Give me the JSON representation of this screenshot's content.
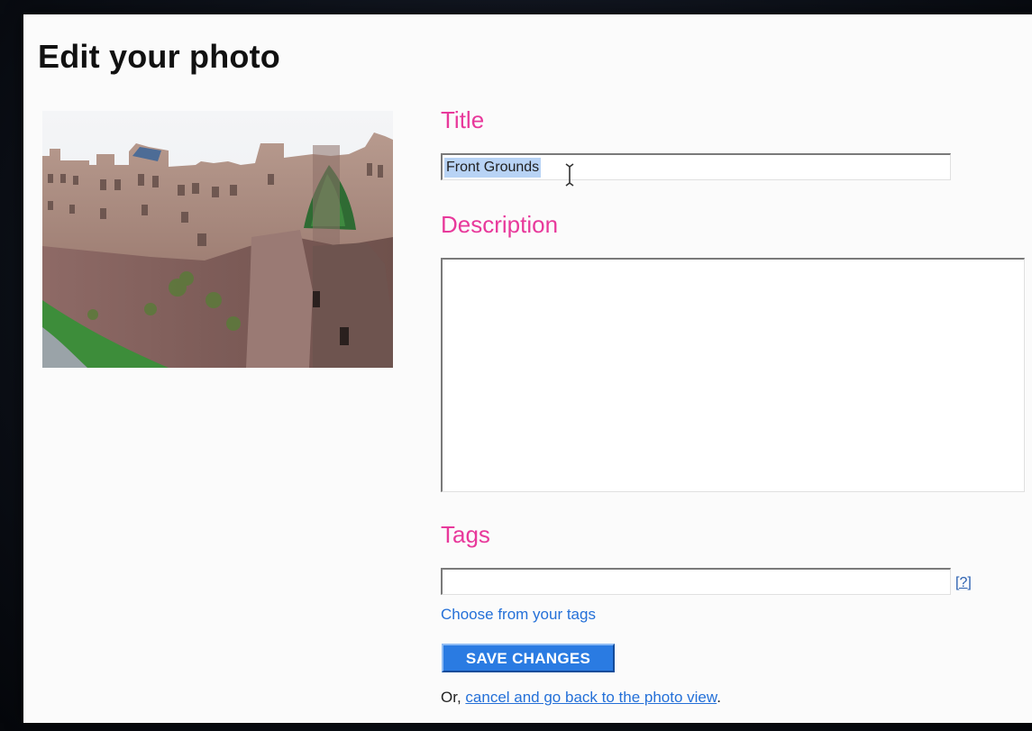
{
  "page": {
    "title": "Edit your photo"
  },
  "form": {
    "title_label": "Title",
    "title_value": "Front Grounds",
    "description_label": "Description",
    "description_value": "",
    "tags_label": "Tags",
    "tags_value": "",
    "tags_help": "[?]",
    "choose_tags_link": "Choose from your tags",
    "save_button": "SAVE CHANGES",
    "cancel_prefix": "Or, ",
    "cancel_link": "cancel and go back to the photo view",
    "cancel_suffix": "."
  },
  "colors": {
    "label_pink": "#e8399b",
    "link_blue": "#2470d8",
    "button_blue": "#2a7be2",
    "selection": "#b8d3f5"
  },
  "icons": {
    "cursor": "text-cursor-icon"
  }
}
